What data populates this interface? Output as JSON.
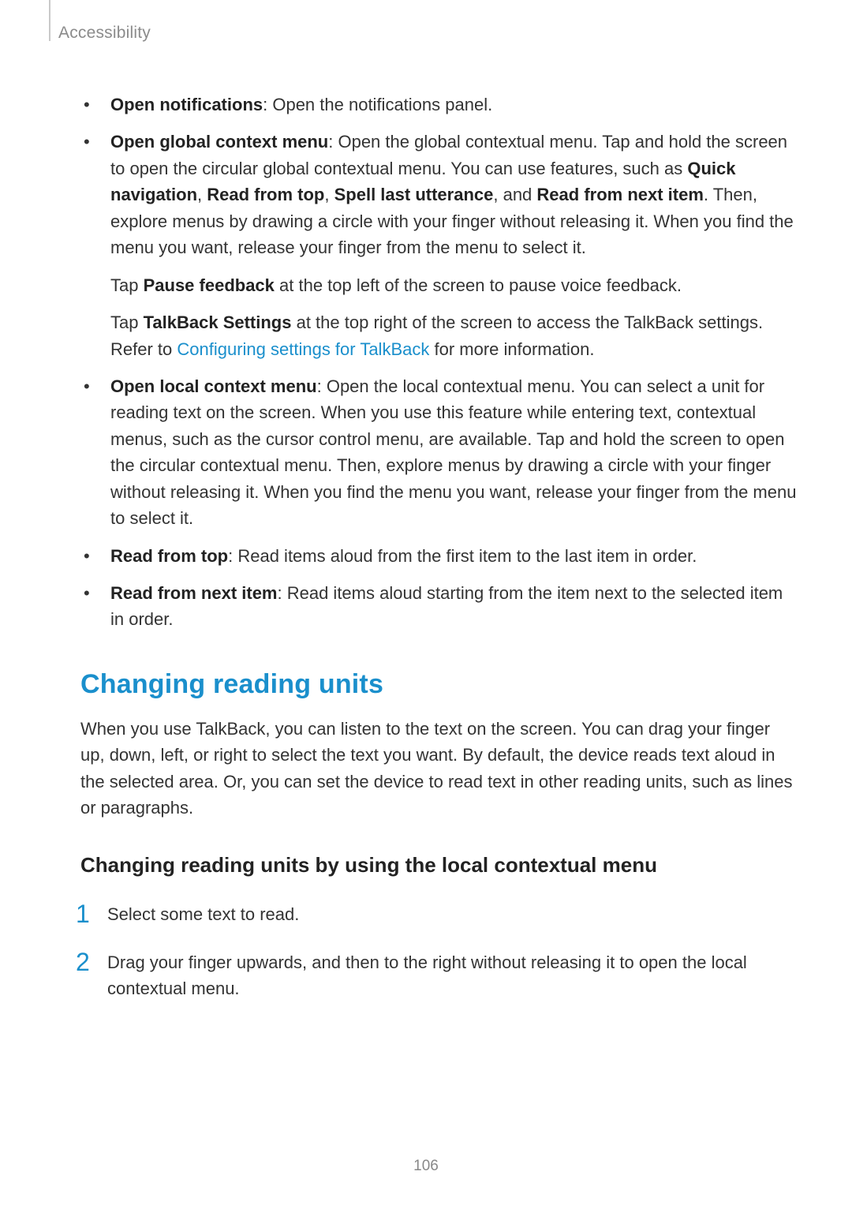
{
  "header": {
    "breadcrumb": "Accessibility"
  },
  "bullets": {
    "b1_label": "Open notifications",
    "b1_text": ": Open the notifications panel.",
    "b2_label": "Open global context menu",
    "b2_text1": ": Open the global contextual menu. Tap and hold the screen to open the circular global contextual menu. You can use features, such as ",
    "b2_bold_quick": "Quick navigation",
    "b2_comma1": ", ",
    "b2_bold_rft": "Read from top",
    "b2_comma2": ", ",
    "b2_bold_slu": "Spell last utterance",
    "b2_and": ", and ",
    "b2_bold_rfni": "Read from next item",
    "b2_text2": ". Then, explore menus by drawing a circle with your finger without releasing it. When you find the menu you want, release your finger from the menu to select it.",
    "b2_p2_pre": "Tap ",
    "b2_p2_bold": "Pause feedback",
    "b2_p2_post": " at the top left of the screen to pause voice feedback.",
    "b2_p3_pre": "Tap ",
    "b2_p3_bold": "TalkBack Settings",
    "b2_p3_mid": " at the top right of the screen to access the TalkBack settings. Refer to ",
    "b2_p3_link": "Configuring settings for TalkBack",
    "b2_p3_post": " for more information.",
    "b3_label": "Open local context menu",
    "b3_text": ": Open the local contextual menu. You can select a unit for reading text on the screen. When you use this feature while entering text, contextual menus, such as the cursor control menu, are available. Tap and hold the screen to open the circular contextual menu. Then, explore menus by drawing a circle with your finger without releasing it. When you find the menu you want, release your finger from the menu to select it.",
    "b4_label": "Read from top",
    "b4_text": ": Read items aloud from the first item to the last item in order.",
    "b5_label": "Read from next item",
    "b5_text": ": Read items aloud starting from the item next to the selected item in order."
  },
  "section": {
    "title": "Changing reading units",
    "para": "When you use TalkBack, you can listen to the text on the screen. You can drag your finger up, down, left, or right to select the text you want. By default, the device reads text aloud in the selected area. Or, you can set the device to read text in other reading units, such as lines or paragraphs.",
    "subheading": "Changing reading units by using the local contextual menu"
  },
  "steps": {
    "s1_num": "1",
    "s1_text": "Select some text to read.",
    "s2_num": "2",
    "s2_text": "Drag your finger upwards, and then to the right without releasing it to open the local contextual menu."
  },
  "page_number": "106"
}
